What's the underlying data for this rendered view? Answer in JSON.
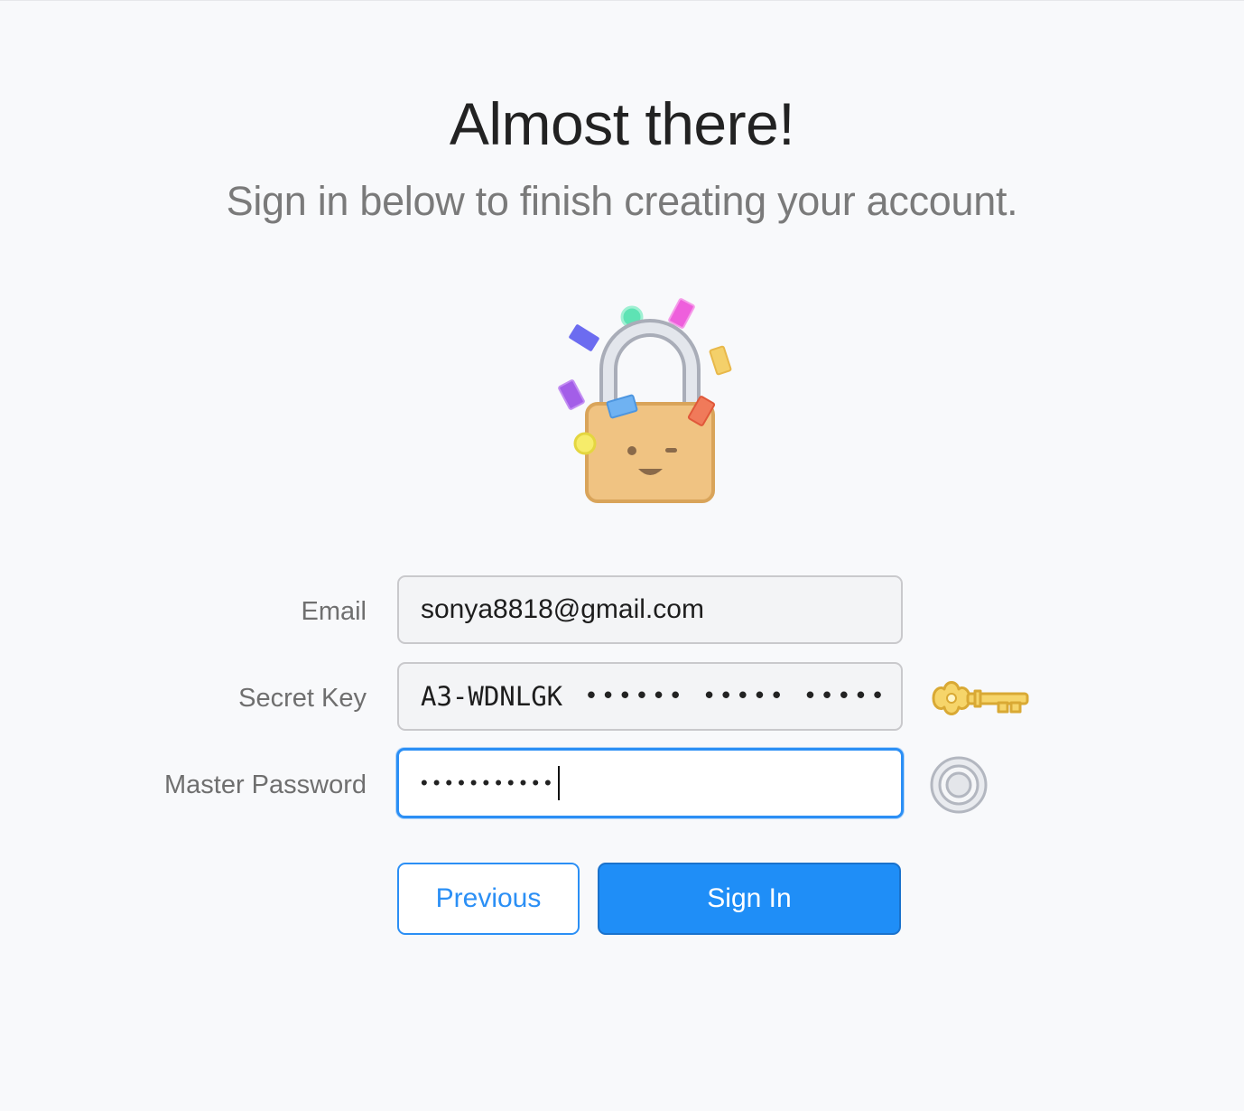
{
  "header": {
    "title": "Almost there!",
    "subtitle": "Sign in below to finish creating your account."
  },
  "illustration": {
    "name": "winking-padlock-confetti"
  },
  "form": {
    "email": {
      "label": "Email",
      "value": "sonya8818@gmail.com"
    },
    "secret_key": {
      "label": "Secret Key",
      "visible_prefix": "A3-WDNLGK",
      "masked_value": "•••••• ••••• •••••",
      "icon": "golden-key-icon"
    },
    "master_password": {
      "label": "Master Password",
      "masked_value": "•••••••••••",
      "icon": "vault-dial-icon",
      "focused": true
    }
  },
  "buttons": {
    "previous_label": "Previous",
    "sign_in_label": "Sign In"
  },
  "colors": {
    "accent": "#1f8ef7",
    "background": "#f8f9fb",
    "lock_body": "#f0c382",
    "key_gold": "#f6d56a"
  }
}
